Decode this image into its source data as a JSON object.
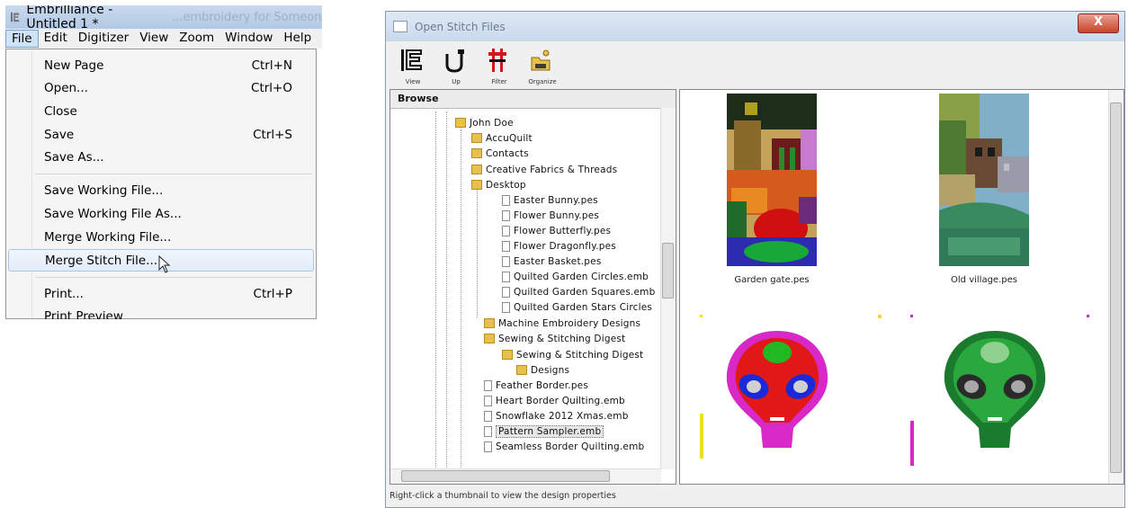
{
  "app": {
    "title": "Embrilliance - Untitled 1 *",
    "title_ghost": "...embroidery for Someone Special",
    "menubar": [
      "File",
      "Edit",
      "Digitizer",
      "View",
      "Zoom",
      "Window",
      "Help"
    ],
    "file_menu": [
      {
        "label": "New Page",
        "shortcut": "Ctrl+N"
      },
      {
        "label": "Open...",
        "shortcut": "Ctrl+O"
      },
      {
        "label": "Close",
        "shortcut": ""
      },
      {
        "label": "Save",
        "shortcut": "Ctrl+S"
      },
      {
        "label": "Save As...",
        "shortcut": ""
      },
      {
        "label": "Save Working File...",
        "shortcut": ""
      },
      {
        "label": "Save Working File As...",
        "shortcut": ""
      },
      {
        "label": "Merge Working File...",
        "shortcut": ""
      },
      {
        "label": "Merge Stitch File...",
        "shortcut": ""
      },
      {
        "label": "Print...",
        "shortcut": "Ctrl+P"
      },
      {
        "label": "Print Preview",
        "shortcut": ""
      }
    ],
    "highlighted_item": "Merge Stitch File..."
  },
  "dialog": {
    "title": "Open Stitch Files",
    "close_label": "X",
    "toolbar": [
      {
        "label": "View",
        "icon": "view-icon"
      },
      {
        "label": "Up",
        "icon": "up-icon"
      },
      {
        "label": "Filter",
        "icon": "filter-icon"
      },
      {
        "label": "Organize",
        "icon": "organize-icon"
      }
    ],
    "tree_header": "Browse",
    "tree": [
      {
        "label": "John Doe",
        "type": "folder",
        "depth": 0
      },
      {
        "label": "AccuQuilt",
        "type": "folder",
        "depth": 1
      },
      {
        "label": "Contacts",
        "type": "folder",
        "depth": 1
      },
      {
        "label": "Creative Fabrics & Threads",
        "type": "folder",
        "depth": 1
      },
      {
        "label": "Desktop",
        "type": "folder",
        "depth": 1
      },
      {
        "label": "Easter Bunny.pes",
        "type": "file",
        "depth": 2
      },
      {
        "label": "Flower Bunny.pes",
        "type": "file",
        "depth": 2
      },
      {
        "label": "Flower Butterfly.pes",
        "type": "file",
        "depth": 2
      },
      {
        "label": "Flower Dragonfly.pes",
        "type": "file",
        "depth": 2
      },
      {
        "label": "Easter Basket.pes",
        "type": "file",
        "depth": 2
      },
      {
        "label": "Quilted Garden Circles.emb",
        "type": "file",
        "depth": 2
      },
      {
        "label": "Quilted Garden Squares.emb",
        "type": "file",
        "depth": 2
      },
      {
        "label": "Quilted Garden Stars Circles",
        "type": "file",
        "depth": 2
      },
      {
        "label": "Machine Embroidery Designs",
        "type": "folder",
        "depth": 1
      },
      {
        "label": "Sewing & Stitching Digest",
        "type": "folder",
        "depth": 1
      },
      {
        "label": "Sewing & Stitching Digest",
        "type": "folder",
        "depth": 2
      },
      {
        "label": "Designs",
        "type": "folder",
        "depth": 3
      },
      {
        "label": "Feather Border.pes",
        "type": "file",
        "depth": 2
      },
      {
        "label": "Heart Border Quilting.emb",
        "type": "file",
        "depth": 2
      },
      {
        "label": "Snowflake 2012 Xmas.emb",
        "type": "file",
        "depth": 2
      },
      {
        "label": "Pattern Sampler.emb",
        "type": "file",
        "depth": 2,
        "selected": true
      },
      {
        "label": "Seamless Border Quilting.emb",
        "type": "file",
        "depth": 2
      }
    ],
    "thumbnails": [
      {
        "caption": "Garden gate.pes"
      },
      {
        "caption": "Old village.pes"
      },
      {
        "caption": "",
        "name": "alien-red"
      },
      {
        "caption": "",
        "name": "alien-green"
      }
    ],
    "status": "Right-click a thumbnail to view the design properties"
  }
}
